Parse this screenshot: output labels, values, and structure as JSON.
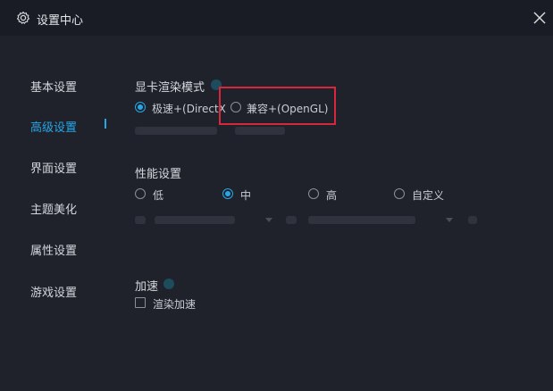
{
  "window": {
    "title": "设置中心"
  },
  "sidebar": {
    "items": [
      {
        "label": "基本设置"
      },
      {
        "label": "高级设置"
      },
      {
        "label": "界面设置"
      },
      {
        "label": "主题美化"
      },
      {
        "label": "属性设置"
      },
      {
        "label": "游戏设置"
      }
    ],
    "active_index": 1
  },
  "render_mode": {
    "title": "显卡渲染模式",
    "options": [
      {
        "label": "极速+(DirectX",
        "checked": true
      },
      {
        "label": "兼容+(OpenGL)",
        "checked": false
      }
    ]
  },
  "performance": {
    "title": "性能设置",
    "options": [
      {
        "label": "低",
        "checked": false
      },
      {
        "label": "中",
        "checked": true
      },
      {
        "label": "高",
        "checked": false
      },
      {
        "label": "自定义",
        "checked": false
      }
    ]
  },
  "acceleration": {
    "title": "加速",
    "checkbox_label": "渲染加速",
    "checked": false
  },
  "colors": {
    "accent": "#27a6e8",
    "background": "#1f222b",
    "titlebar": "#191c24",
    "highlight": "#d8263b"
  },
  "icons": {
    "settings": "gear-icon",
    "close": "close-icon",
    "help": "help-icon"
  }
}
